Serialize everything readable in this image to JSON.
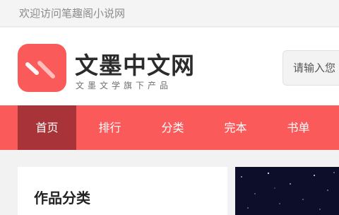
{
  "topbar": {
    "welcome": "欢迎访问笔趣阁小说网"
  },
  "header": {
    "brand_name": "文墨中文网",
    "brand_slogan": "文墨文学旗下产品",
    "search_placeholder": "请输入您",
    "brand_color": "#fb5a5b"
  },
  "nav": {
    "items": [
      {
        "label": "首页",
        "active": true
      },
      {
        "label": "排行"
      },
      {
        "label": "分类"
      },
      {
        "label": "完本"
      },
      {
        "label": "书单"
      }
    ],
    "bar_color": "#fb5a5b",
    "active_color": "#a8343a"
  },
  "main": {
    "category_title": "作品分类"
  }
}
